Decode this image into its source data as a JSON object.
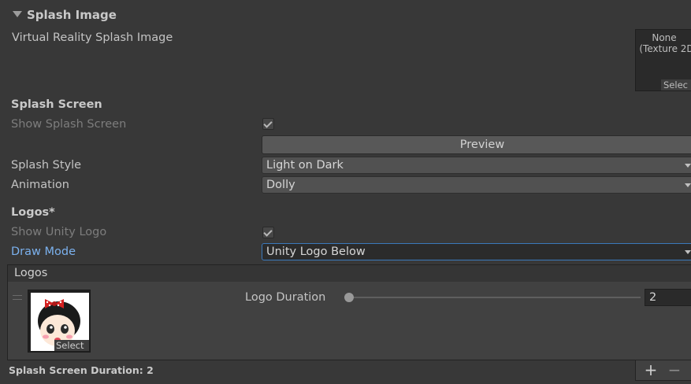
{
  "section": {
    "title": "Splash Image"
  },
  "vr_splash": {
    "label": "Virtual Reality Splash Image",
    "slot_line1": "None",
    "slot_line2": "(Texture 2D",
    "slot_select": "Selec"
  },
  "splash_screen": {
    "heading": "Splash Screen",
    "show_label": "Show Splash Screen",
    "show_checked": true,
    "preview_button": "Preview",
    "style_label": "Splash Style",
    "style_value": "Light on Dark",
    "animation_label": "Animation",
    "animation_value": "Dolly"
  },
  "logos": {
    "heading": "Logos*",
    "show_unity_logo_label": "Show Unity Logo",
    "show_unity_logo_checked": true,
    "draw_mode_label": "Draw Mode",
    "draw_mode_value": "Unity Logo Below",
    "list_header": "Logos",
    "items": [
      {
        "select_label": "Select",
        "duration_label": "Logo Duration",
        "duration_value": "2"
      }
    ]
  },
  "footer": {
    "duration_text": "Splash Screen Duration: 2",
    "add_glyph": "+",
    "remove_glyph": "−"
  },
  "icons": {
    "foldout": "triangle-down-icon",
    "check": "checkmark-icon",
    "dropdown": "chevron-down-icon",
    "drag": "drag-handle-icon"
  },
  "colors": {
    "background": "#383838",
    "focus_blue": "#3a79bb",
    "label_blue": "#7bb1ee"
  }
}
